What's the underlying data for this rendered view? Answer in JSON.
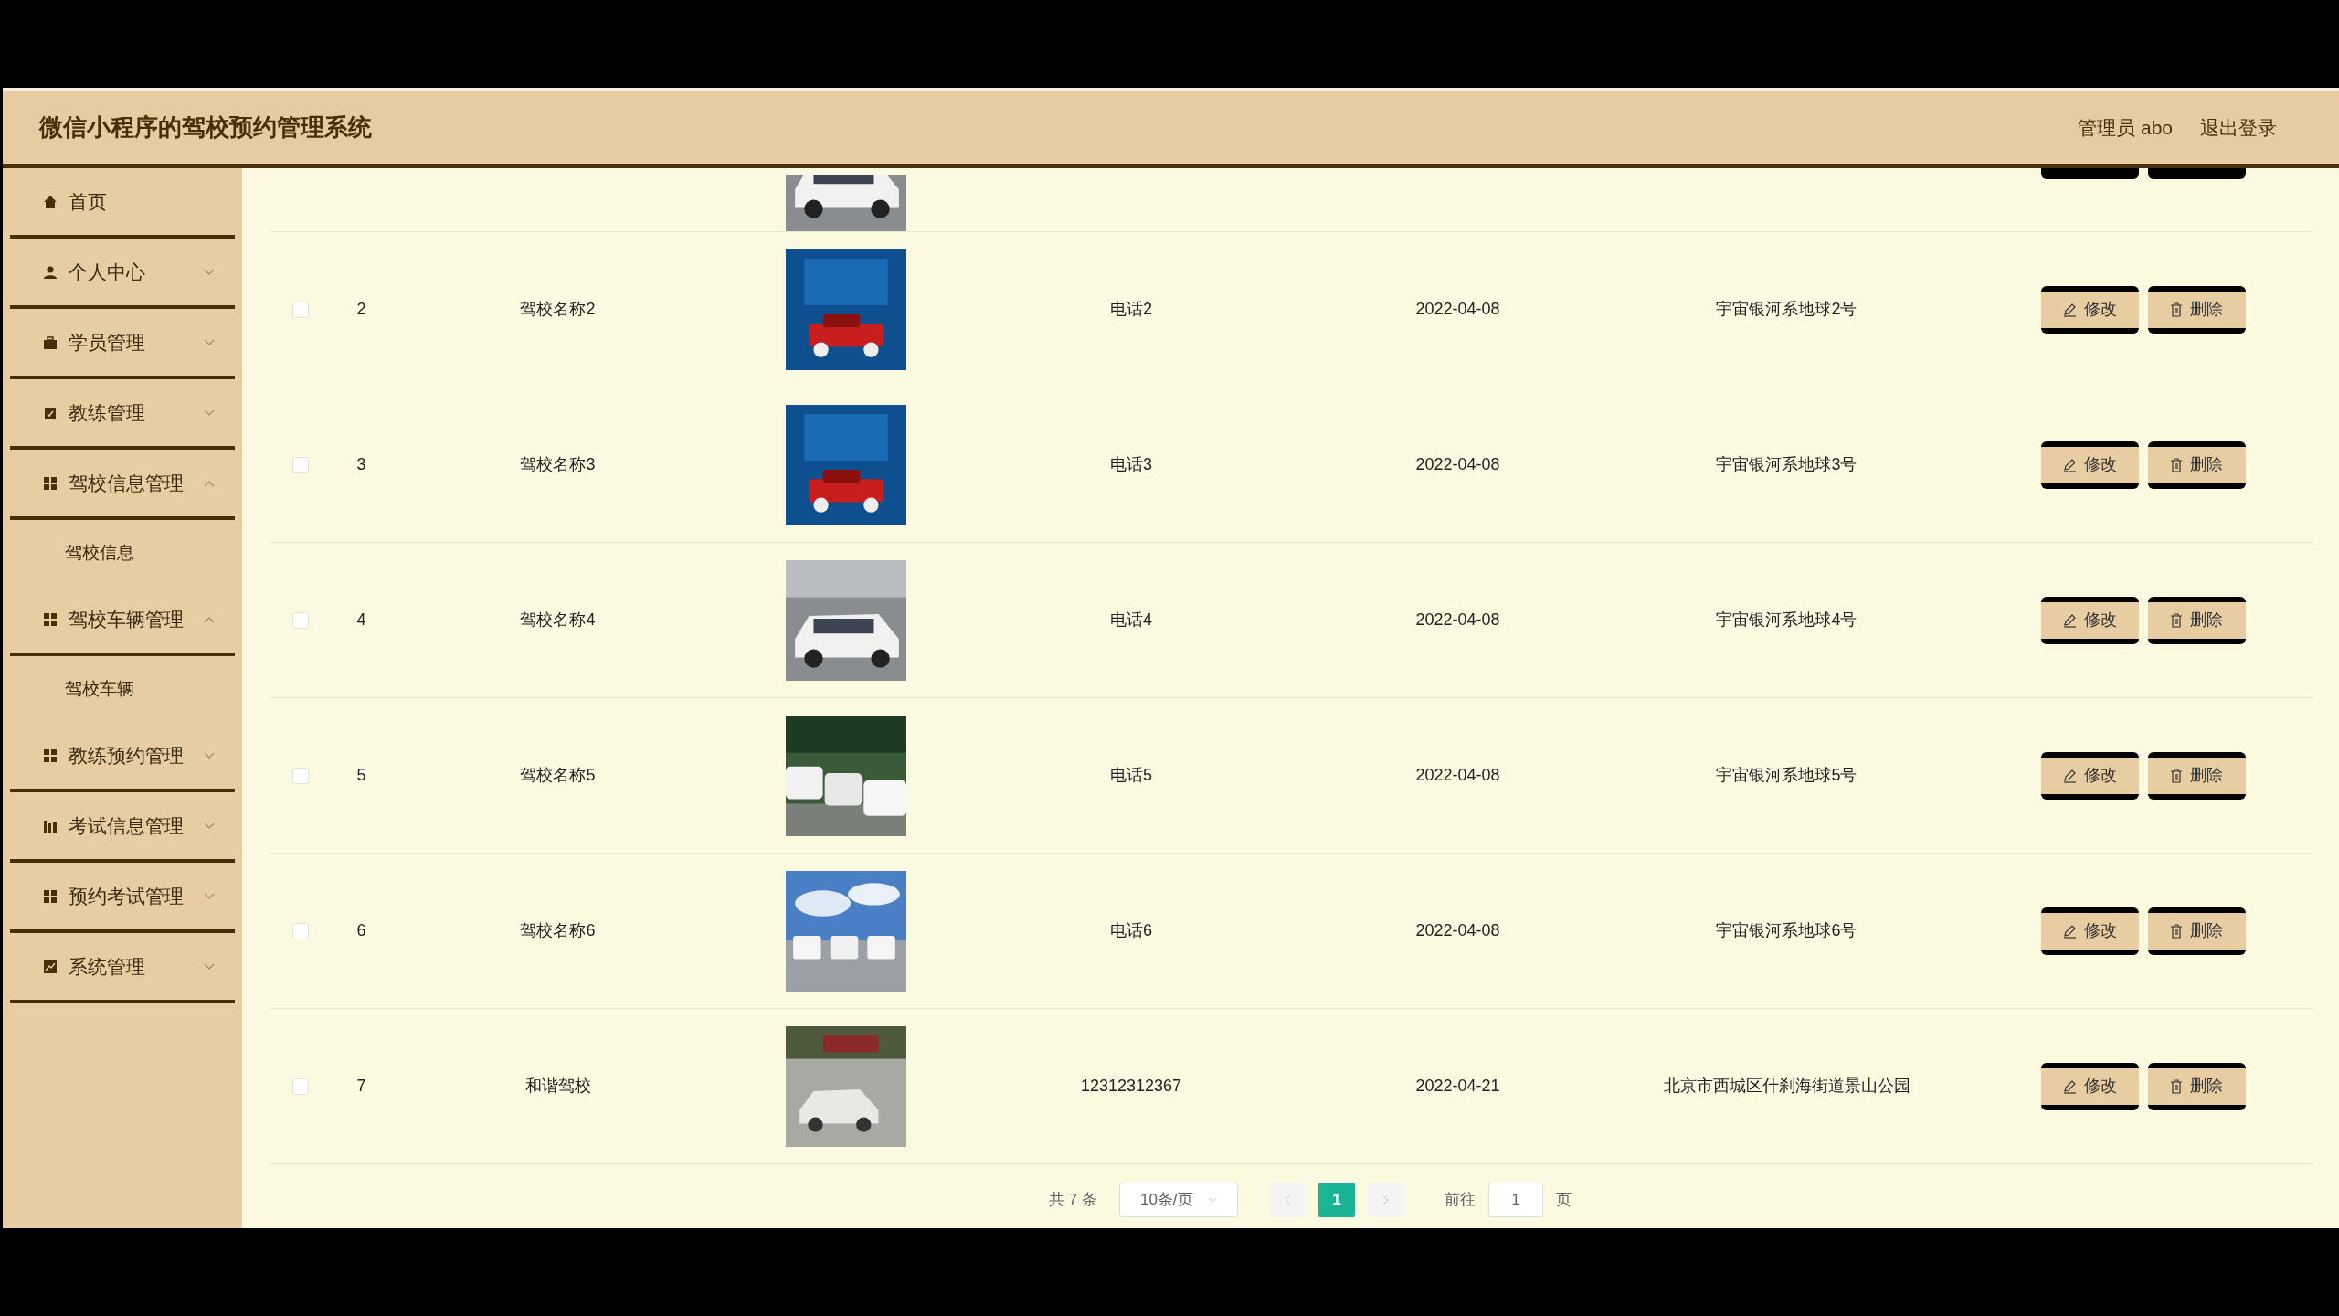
{
  "header": {
    "title": "微信小程序的驾校预约管理系统",
    "user": "管理员 abo",
    "logout": "退出登录"
  },
  "sidebar": {
    "items": [
      {
        "label": "首页",
        "kind": "link"
      },
      {
        "label": "个人中心",
        "kind": "menu",
        "expanded": false
      },
      {
        "label": "学员管理",
        "kind": "menu",
        "expanded": false
      },
      {
        "label": "教练管理",
        "kind": "menu",
        "expanded": false
      },
      {
        "label": "驾校信息管理",
        "kind": "menu",
        "expanded": true,
        "children": [
          {
            "label": "驾校信息"
          }
        ]
      },
      {
        "label": "驾校车辆管理",
        "kind": "menu",
        "expanded": true,
        "children": [
          {
            "label": "驾校车辆"
          }
        ]
      },
      {
        "label": "教练预约管理",
        "kind": "menu",
        "expanded": false
      },
      {
        "label": "考试信息管理",
        "kind": "menu",
        "expanded": false
      },
      {
        "label": "预约考试管理",
        "kind": "menu",
        "expanded": false
      },
      {
        "label": "系统管理",
        "kind": "menu",
        "expanded": false
      }
    ]
  },
  "table": {
    "rows": [
      {
        "checked": false,
        "index": "2",
        "name": "驾校名称2",
        "phone": "电话2",
        "date": "2022-04-08",
        "address": "宇宙银河系地球2号",
        "edit": "修改",
        "delete": "删除"
      },
      {
        "checked": false,
        "index": "3",
        "name": "驾校名称3",
        "phone": "电话3",
        "date": "2022-04-08",
        "address": "宇宙银河系地球3号",
        "edit": "修改",
        "delete": "删除"
      },
      {
        "checked": false,
        "index": "4",
        "name": "驾校名称4",
        "phone": "电话4",
        "date": "2022-04-08",
        "address": "宇宙银河系地球4号",
        "edit": "修改",
        "delete": "删除"
      },
      {
        "checked": false,
        "index": "5",
        "name": "驾校名称5",
        "phone": "电话5",
        "date": "2022-04-08",
        "address": "宇宙银河系地球5号",
        "edit": "修改",
        "delete": "删除"
      },
      {
        "checked": false,
        "index": "6",
        "name": "驾校名称6",
        "phone": "电话6",
        "date": "2022-04-08",
        "address": "宇宙银河系地球6号",
        "edit": "修改",
        "delete": "删除"
      },
      {
        "checked": false,
        "index": "7",
        "name": "和谐驾校",
        "phone": "12312312367",
        "date": "2022-04-21",
        "address": "北京市西城区什刹海街道景山公园",
        "edit": "修改",
        "delete": "删除"
      }
    ]
  },
  "pagination": {
    "total": "共 7 条",
    "page_size": "10条/页",
    "pages": [
      {
        "label": "1",
        "selected": true
      }
    ],
    "goto": "前往",
    "goto_value": "1",
    "goto_suffix": "页"
  }
}
